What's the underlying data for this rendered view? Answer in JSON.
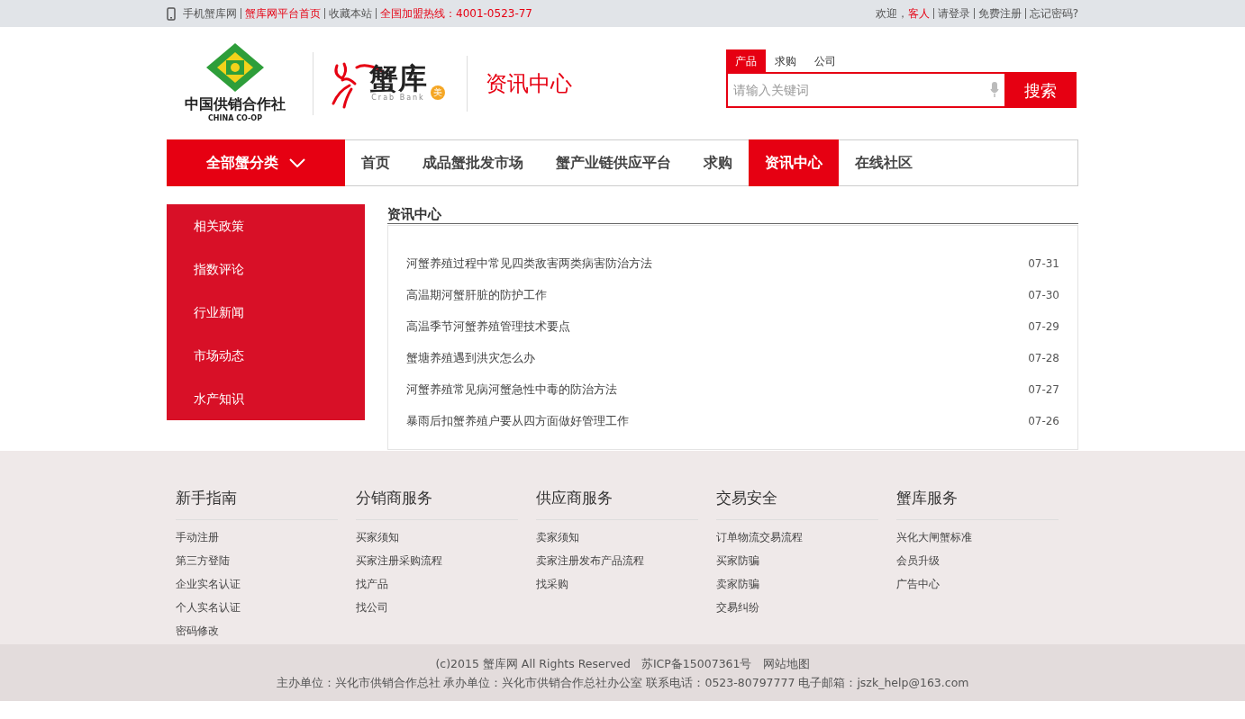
{
  "top_bar": {
    "left": [
      {
        "text": "手机蟹库网",
        "highlighted": false
      },
      {
        "text": "蟹库网平台首页",
        "highlighted": true
      },
      {
        "text": "收藏本站",
        "highlighted": false
      },
      {
        "text": "全国加盟热线：4001-0523-77",
        "highlighted": true
      }
    ],
    "greeting": "欢迎，",
    "user": "客人",
    "right": [
      "请登录",
      "免费注册",
      "忘记密码?"
    ]
  },
  "header": {
    "coop_logo": {
      "name": "中国供销合作社",
      "subtitle": "CHINA CO-OP"
    },
    "crab_logo": {
      "name": "蟹库",
      "subtitle": "Crab Bank",
      "badge": "美"
    },
    "section_title": "资讯中心",
    "search": {
      "tabs": [
        {
          "label": "产品",
          "selected": true
        },
        {
          "label": "求购",
          "selected": false
        },
        {
          "label": "公司",
          "selected": false
        }
      ],
      "placeholder": "请输入关键词",
      "button": "搜索"
    }
  },
  "nav": {
    "category": "全部蟹分类",
    "items": [
      {
        "label": "首页",
        "selected": false
      },
      {
        "label": "成品蟹批发市场",
        "selected": false
      },
      {
        "label": "蟹产业链供应平台",
        "selected": false
      },
      {
        "label": "求购",
        "selected": false
      },
      {
        "label": "资讯中心",
        "selected": true
      },
      {
        "label": "在线社区",
        "selected": false
      }
    ]
  },
  "sidebar": {
    "items": [
      "相关政策",
      "指数评论",
      "行业新闻",
      "市场动态",
      "水产知识"
    ]
  },
  "news": {
    "title": "资讯中心",
    "items": [
      {
        "title": "河蟹养殖过程中常见四类敌害两类病害防治方法",
        "date": "07-31"
      },
      {
        "title": "高温期河蟹肝脏的防护工作",
        "date": "07-30"
      },
      {
        "title": "高温季节河蟹养殖管理技术要点",
        "date": "07-29"
      },
      {
        "title": "蟹塘养殖遇到洪灾怎么办",
        "date": "07-28"
      },
      {
        "title": "河蟹养殖常见病河蟹急性中毒的防治方法",
        "date": "07-27"
      },
      {
        "title": "暴雨后扣蟹养殖户要从四方面做好管理工作",
        "date": "07-26"
      }
    ]
  },
  "footer": {
    "columns": [
      {
        "title": "新手指南",
        "links": [
          "手动注册",
          "第三方登陆",
          "企业实名认证",
          "个人实名认证",
          "密码修改"
        ]
      },
      {
        "title": "分销商服务",
        "links": [
          "买家须知",
          "买家注册采购流程",
          "找产品",
          "找公司"
        ]
      },
      {
        "title": "供应商服务",
        "links": [
          "卖家须知",
          "卖家注册发布产品流程",
          "找采购"
        ]
      },
      {
        "title": "交易安全",
        "links": [
          "订单物流交易流程",
          "买家防骗",
          "卖家防骗",
          "交易纠纷"
        ]
      },
      {
        "title": "蟹库服务",
        "links": [
          "兴化大闸蟹标准",
          "会员升级",
          "广告中心"
        ]
      }
    ],
    "copyright": [
      "(c)2015 蟹库网 All Rights Reserved",
      "苏ICP备15007361号",
      "网站地图"
    ],
    "contact": "主办单位：兴化市供销合作总社 承办单位：兴化市供销合作总社办公室 联系电话：0523-80797777 电子邮箱：jszk_help@163.com"
  }
}
